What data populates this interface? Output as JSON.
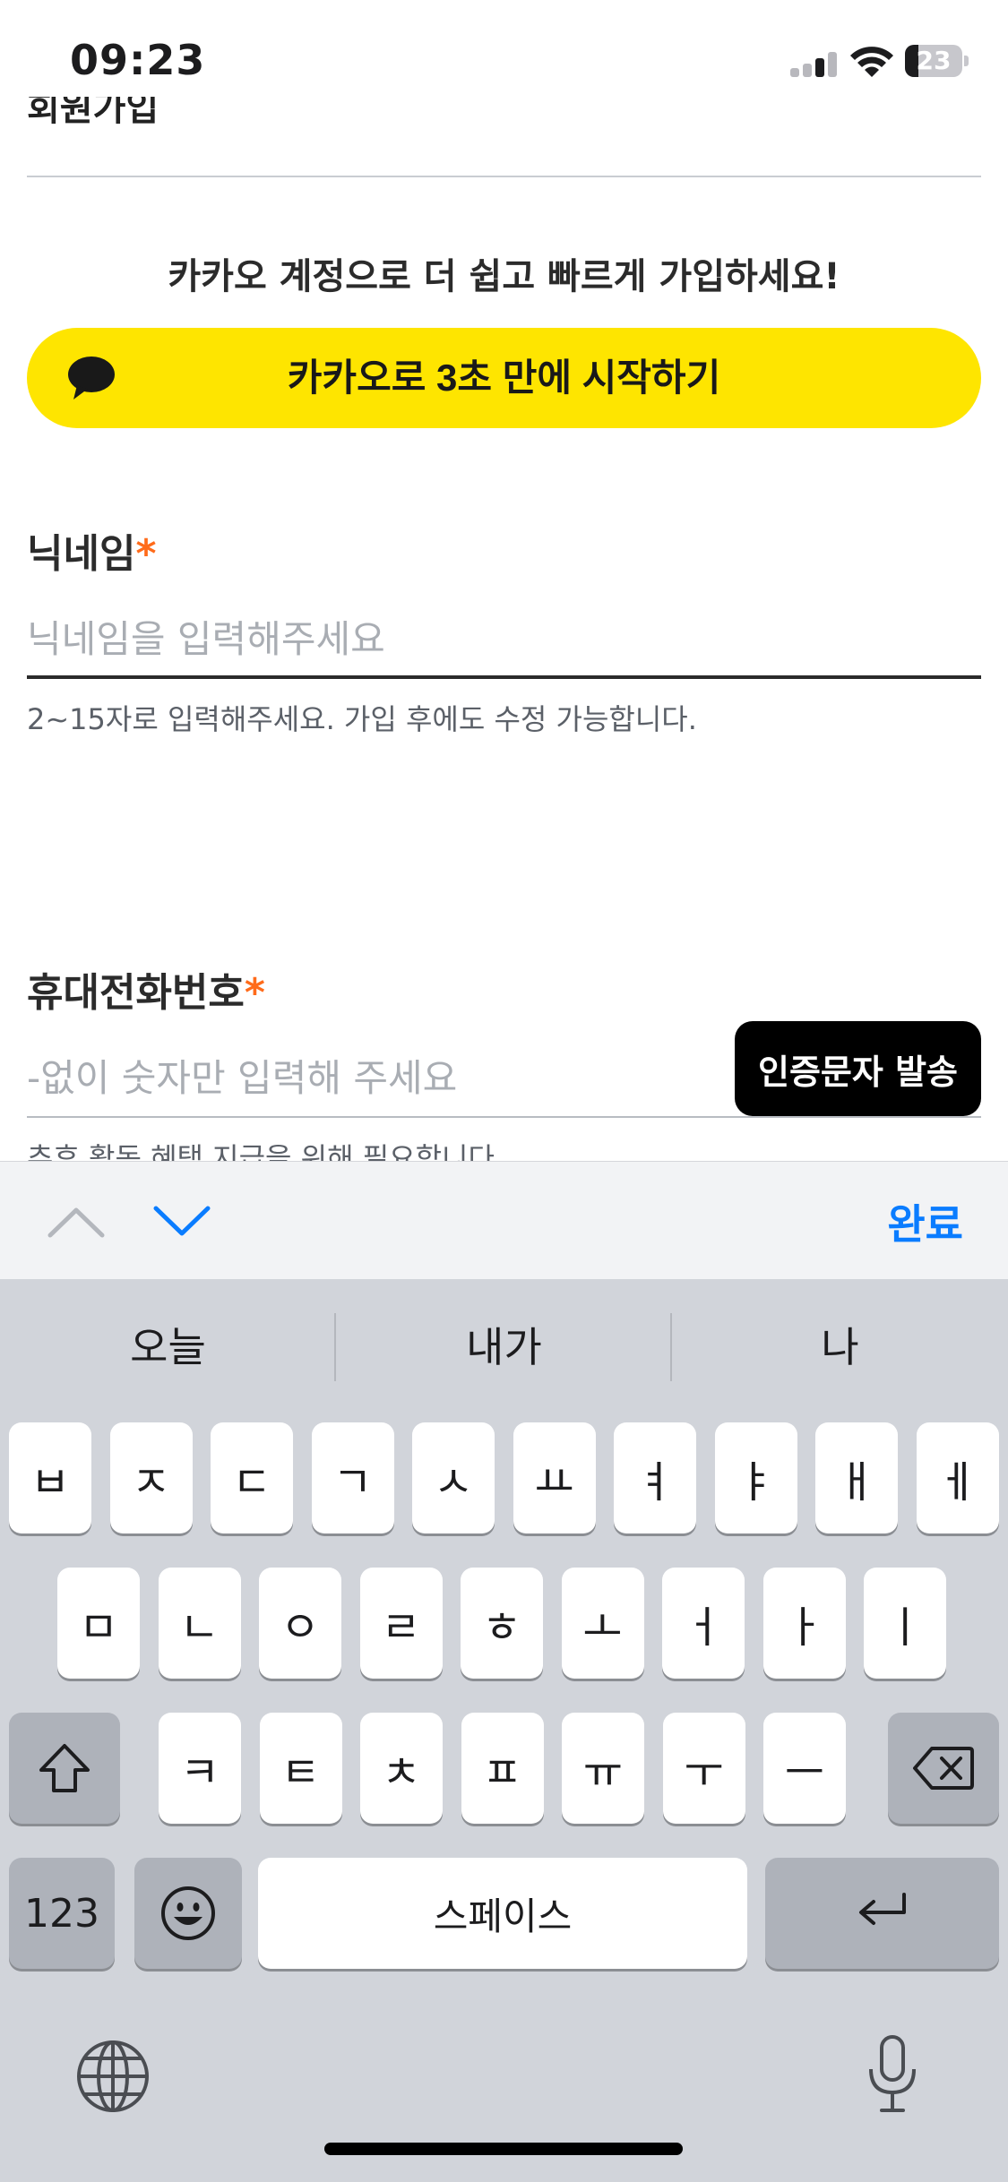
{
  "status_bar": {
    "time": "09:23",
    "battery": "23",
    "battery_level": 0.23
  },
  "header": {
    "title": "회원가입"
  },
  "kakao": {
    "promo": "카카오 계정으로 더 쉽고 빠르게 가입하세요!",
    "button_label": "카카오로 3초 만에 시작하기",
    "brand_color": "#FEE500"
  },
  "nickname": {
    "label": "닉네임",
    "required_mark": "*",
    "placeholder": "닉네임을 입력해주세요",
    "value": "",
    "helper": "2~15자로 입력해주세요. 가입 후에도 수정 가능합니다."
  },
  "phone": {
    "label": "휴대전화번호",
    "required_mark": "*",
    "placeholder": "-없이 숫자만 입력해 주세요",
    "value": "",
    "send_button": "인증문자 발송",
    "helper": "추후 활동 혜택 지급을 위해 필요합니다"
  },
  "accessory": {
    "up_icon": "chevron-up-icon",
    "down_icon": "chevron-down-icon",
    "done_label": "완료",
    "done_color": "#0a7cff"
  },
  "keyboard": {
    "suggestions": [
      "오늘",
      "내가",
      "나"
    ],
    "row1": [
      "ㅂ",
      "ㅈ",
      "ㄷ",
      "ㄱ",
      "ㅅ",
      "ㅛ",
      "ㅕ",
      "ㅑ",
      "ㅐ",
      "ㅔ"
    ],
    "row2": [
      "ㅁ",
      "ㄴ",
      "ㅇ",
      "ㄹ",
      "ㅎ",
      "ㅗ",
      "ㅓ",
      "ㅏ",
      "ㅣ"
    ],
    "row3": [
      "ㅋ",
      "ㅌ",
      "ㅊ",
      "ㅍ",
      "ㅠ",
      "ㅜ",
      "ㅡ"
    ],
    "numbers_key": "123",
    "space_key": "스페이스",
    "shift_icon": "shift-icon",
    "backspace_icon": "backspace-icon",
    "emoji_icon": "emoji-icon",
    "return_icon": "return-icon",
    "globe_icon": "globe-icon",
    "mic_icon": "microphone-icon"
  }
}
